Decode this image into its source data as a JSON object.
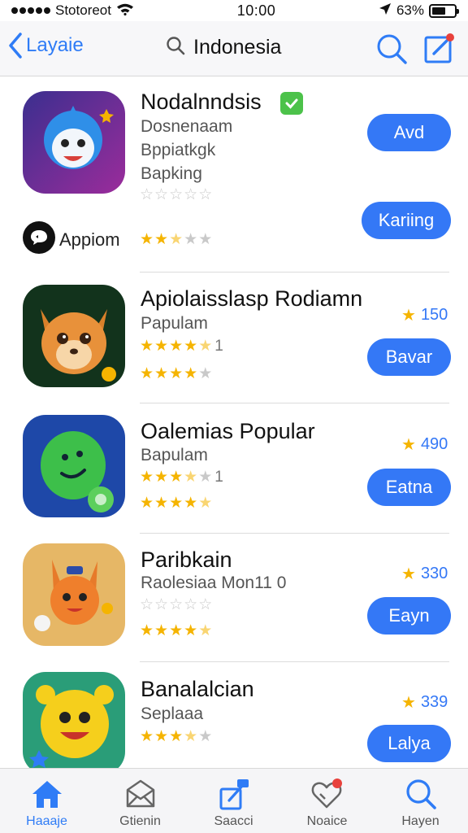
{
  "status_bar": {
    "carrier": "Stotoreot",
    "time": "10:00",
    "battery": "63%",
    "battery_level": 0.63
  },
  "nav": {
    "back_label": "Layaie",
    "title": "Indonesia",
    "accent_color": "#2f7cf6"
  },
  "apps": [
    {
      "name": "Nodalnndsis",
      "lines": [
        "Dosnenaam",
        "Bppiatkgk",
        "Bapking"
      ],
      "rating": 0,
      "button_label": "Avd",
      "verified_icon": "check-badge-icon"
    },
    {
      "name": "Apiolaisslasp Rodiamn",
      "lines": [
        "Papulam"
      ],
      "rating_text_suffix": "1",
      "button_label": "Bavar",
      "rating_count": "150",
      "stars_line1": 4.5,
      "stars_line2": 4
    },
    {
      "name": "Oalemias Popular",
      "lines": [
        "Bapulam"
      ],
      "rating_text_suffix": "1",
      "button_label": "Eatna",
      "rating_count": "490",
      "stars_line1": 3.5,
      "stars_line2": 4.5
    },
    {
      "name": "Paribkain",
      "lines": [
        "Raolesiaa Mon11 0"
      ],
      "button_label": "Eayn",
      "rating_count": "330",
      "stars_line1": 0,
      "stars_line2": 4.5
    },
    {
      "name": "Banalalcian",
      "lines": [
        "Seplaaa"
      ],
      "button_label": "Lalya",
      "rating_count": "339",
      "stars_line1": 3.5
    }
  ],
  "first_app_extra": {
    "chat_label": "Appiom",
    "chat_icon": "chat-bubble-icon",
    "button_label": "Kariing",
    "stars": 2.5
  },
  "tabs": [
    {
      "label": "Haaaje",
      "icon": "home-icon",
      "active": true
    },
    {
      "label": "Gtienin",
      "icon": "envelope-icon",
      "active": false
    },
    {
      "label": "Saacci",
      "icon": "share-icon",
      "active": false
    },
    {
      "label": "Noaice",
      "icon": "heart-notification-icon",
      "active": false
    },
    {
      "label": "Hayen",
      "icon": "search-icon",
      "active": false
    }
  ]
}
